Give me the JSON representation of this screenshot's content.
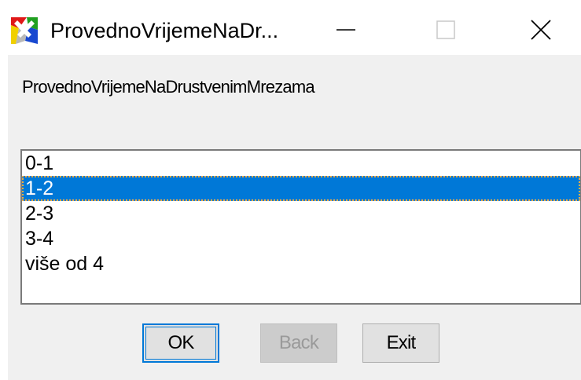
{
  "window": {
    "title": "ProvednoVrijemeNaDr...",
    "icon": "app-icon"
  },
  "titlebar_buttons": {
    "minimize_icon": "minimize-icon",
    "maximize_icon": "maximize-icon",
    "close_icon": "close-icon"
  },
  "prompt": "ProvednoVrijemeNaDrustvenimMrezama",
  "options": [
    {
      "label": "0-1",
      "selected": false
    },
    {
      "label": "1-2",
      "selected": true
    },
    {
      "label": "2-3",
      "selected": false
    },
    {
      "label": "3-4",
      "selected": false
    },
    {
      "label": "više od 4",
      "selected": false
    }
  ],
  "buttons": {
    "ok": {
      "label": "OK",
      "enabled": true
    },
    "back": {
      "label": "Back",
      "enabled": false
    },
    "exit": {
      "label": "Exit",
      "enabled": true
    }
  },
  "colors": {
    "selection": "#0078d7",
    "selection_text": "#ffffff",
    "client_background": "#f0f0f0",
    "default_button_border": "#0078d7"
  }
}
